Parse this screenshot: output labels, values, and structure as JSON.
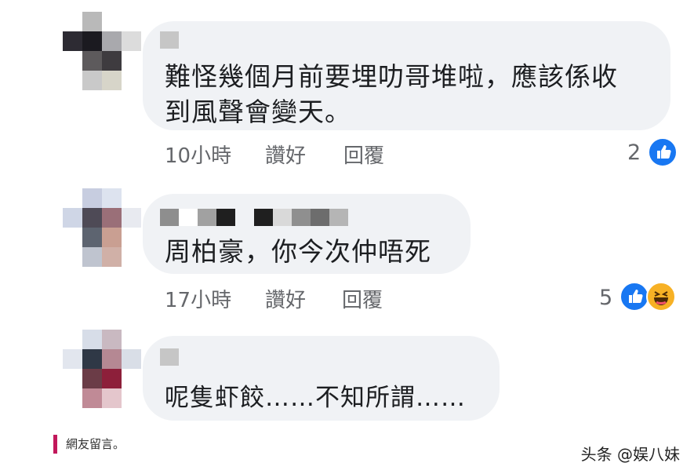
{
  "comments": [
    {
      "text_line1": "難怪幾個月前要埋叻哥堆啦，應該係收",
      "text_line2": "到風聲會變天。",
      "time": "10小時",
      "like_label": "讚好",
      "reply_label": "回覆",
      "reaction_count": "2",
      "reactions": [
        "like-icon"
      ]
    },
    {
      "text_line1": "周柏豪，你今次仲唔死",
      "time": "17小時",
      "like_label": "讚好",
      "reply_label": "回覆",
      "reaction_count": "5",
      "reactions": [
        "like-icon",
        "haha-icon"
      ]
    },
    {
      "text_line1": "呢隻虾餃……不知所謂……"
    }
  ],
  "caption": "網友留言。",
  "watermark": "头条 @娱八妹",
  "colors": {
    "bubble": "#f0f2f5",
    "meta_text": "#65676b",
    "like_blue": "#1877f2",
    "haha_yellow": "#f7b125",
    "caption_bar": "#c2185b"
  }
}
